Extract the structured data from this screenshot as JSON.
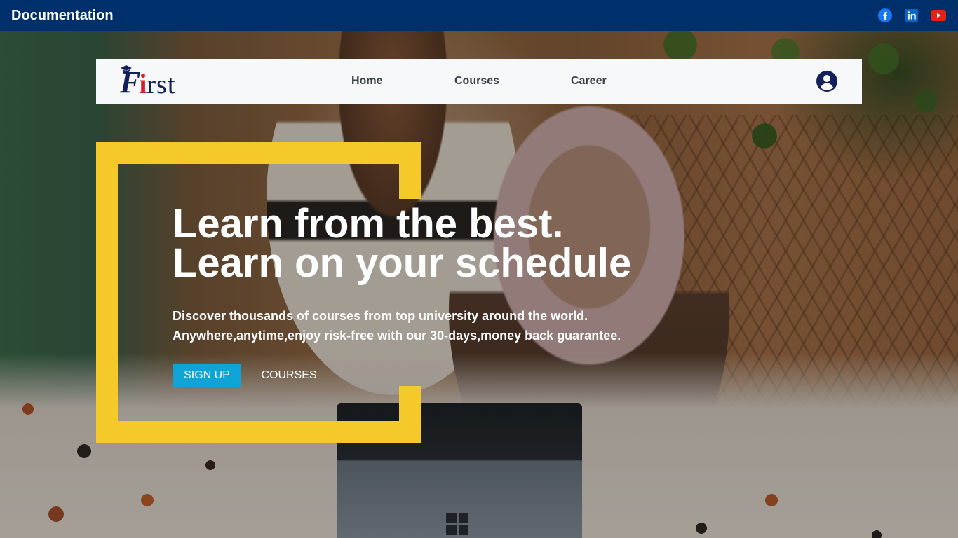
{
  "topbar": {
    "title": "Documentation",
    "social": [
      {
        "name": "facebook-icon",
        "color": "#1877f2"
      },
      {
        "name": "linkedin-icon",
        "color": "#0a66c2"
      },
      {
        "name": "youtube-icon",
        "color": "#e62117"
      }
    ],
    "bg_color": "#00306b"
  },
  "nav": {
    "logo": {
      "part1": "F",
      "part2": "i",
      "part3": "rst"
    },
    "links": {
      "home": "Home",
      "courses": "Courses",
      "career": "Career"
    },
    "user_icon": "user-circle-icon"
  },
  "hero": {
    "headline_line1": "Learn from the best.",
    "headline_line2": "Learn on your schedule",
    "sub_line1": "Discover thousands of courses from top university around the world.",
    "sub_line2": "Anywhere,anytime,enjoy risk-free with our 30-days,money back guarantee.",
    "signup_label": "SIGN UP",
    "courses_label": "COURSES",
    "accent_color": "#f5c92a",
    "button_color": "#0ea5d6"
  }
}
